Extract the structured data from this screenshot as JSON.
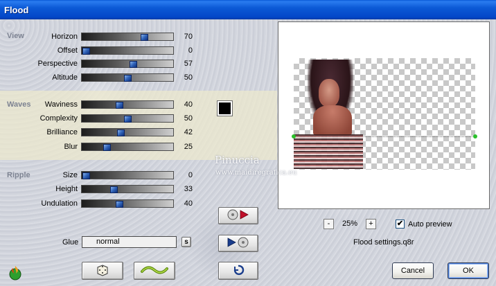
{
  "window": {
    "title": "Flood"
  },
  "sections": {
    "view": "View",
    "waves": "Waves",
    "ripple": "Ripple"
  },
  "sliders": {
    "horizon": {
      "label": "Horizon",
      "value": 70
    },
    "offset": {
      "label": "Offset",
      "value": 0
    },
    "perspective": {
      "label": "Perspective",
      "value": 57
    },
    "altitude": {
      "label": "Altitude",
      "value": 50
    },
    "waviness": {
      "label": "Waviness",
      "value": 40
    },
    "complexity": {
      "label": "Complexity",
      "value": 50
    },
    "brilliance": {
      "label": "Brilliance",
      "value": 42
    },
    "blur": {
      "label": "Blur",
      "value": 25
    },
    "size": {
      "label": "Size",
      "value": 0
    },
    "height": {
      "label": "Height",
      "value": 33
    },
    "undulation": {
      "label": "Undulation",
      "value": 40
    }
  },
  "color_swatch": "#000000",
  "glue": {
    "label": "Glue",
    "value": "normal",
    "button_label": "s"
  },
  "zoom": {
    "minus": "-",
    "value": "25%",
    "plus": "+"
  },
  "auto_preview": {
    "label": "Auto preview",
    "checked": true,
    "mark": "✔"
  },
  "settings_file": "Flood settings.q8r",
  "watermark": {
    "line1": "Pinuccia",
    "line2": "www.maidiregrafica.eu"
  },
  "buttons": {
    "cancel": "Cancel",
    "ok": "OK"
  },
  "icons": {
    "app": "flame-logo-icon",
    "random": "dice-icon",
    "reset": "wave-reset-icon",
    "load": "disc-arrow-icon",
    "save": "arrow-disc-icon",
    "undo": "undo-arrow-icon"
  },
  "colors": {
    "title_bar": "#0c5ad6",
    "band": "#ece8cd",
    "slider_thumb": "#2f62b8"
  }
}
